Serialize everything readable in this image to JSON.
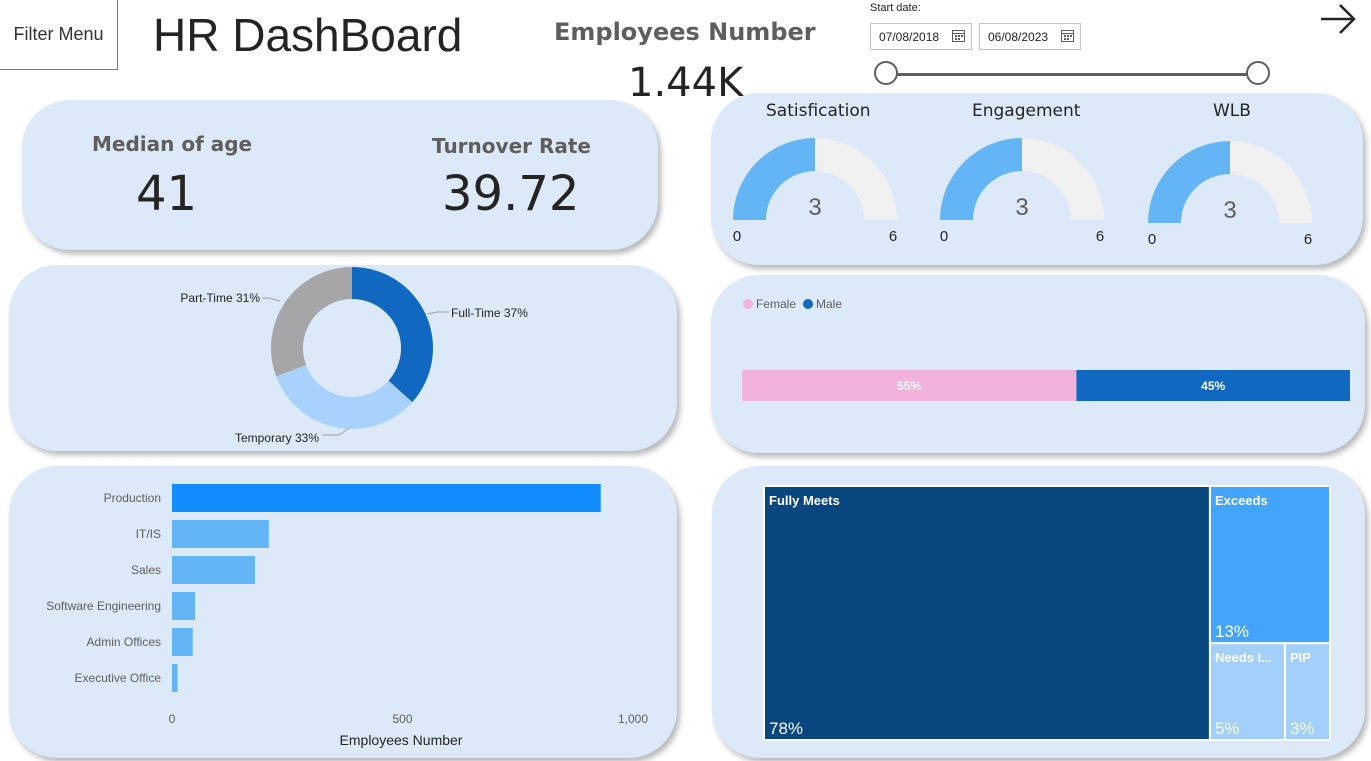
{
  "header": {
    "filter_menu_label": "Filter Menu",
    "title": "HR DashBoard",
    "employees_label": "Employees Number",
    "employees_value": "1.44K",
    "start_date_label": "Start date:",
    "start_date": "07/08/2018",
    "end_date": "06/08/2023",
    "arrow_icon": "arrow-right-icon",
    "slider": {
      "start_position": 0.0,
      "end_position": 1.0
    }
  },
  "kpis": {
    "median_age_label": "Median of age",
    "median_age_value": "41",
    "turnover_label": "Turnover Rate",
    "turnover_value": "39.72"
  },
  "gauges": [
    {
      "title": "Satisfication",
      "value": 3,
      "min": 0,
      "max": 6,
      "value_label": "3",
      "min_label": "0",
      "max_label": "6"
    },
    {
      "title": "Engagement",
      "value": 3,
      "min": 0,
      "max": 6,
      "value_label": "3",
      "min_label": "0",
      "max_label": "6"
    },
    {
      "title": "WLB",
      "value": 3,
      "min": 0,
      "max": 6,
      "value_label": "3",
      "min_label": "0",
      "max_label": "6"
    }
  ],
  "colors": {
    "card_bg": "#dce9f8",
    "gauge_fill": "#64b5f6",
    "gauge_track": "#f0f0f0",
    "female": "#f1b3db",
    "male": "#1068c0",
    "bar_primary": "#118dff",
    "bar_secondary": "#64b5f6",
    "full_time": "#1068c0",
    "temporary": "#a8d1fc",
    "part_time": "#a6a6a8",
    "tree_fully_meets": "#084680",
    "tree_exceeds": "#43a4fc",
    "tree_needs": "#a3cffb",
    "tree_pip": "#a3cffb"
  },
  "chart_data": [
    {
      "type": "pie",
      "donut": true,
      "labels": [
        "Full-Time",
        "Temporary",
        "Part-Time"
      ],
      "values": [
        37,
        33,
        31
      ],
      "data_labels": [
        "Full-Time 37%",
        "Temporary 33%",
        "Part-Time 31%"
      ]
    },
    {
      "type": "bar",
      "stacked": true,
      "orientation": "horizontal",
      "legend": [
        "Female",
        "Male"
      ],
      "legend_position": "top-left",
      "series": [
        {
          "name": "Female",
          "values": [
            55
          ],
          "label": "55%"
        },
        {
          "name": "Male",
          "values": [
            45
          ],
          "label": "45%"
        }
      ]
    },
    {
      "type": "bar",
      "orientation": "horizontal",
      "categories": [
        "Production",
        "IT/IS",
        "Sales",
        "Software Engineering",
        "Admin Offices",
        "Executive Office"
      ],
      "values": [
        930,
        210,
        180,
        50,
        45,
        12
      ],
      "xlabel": "Employees Number",
      "xlim": [
        0,
        1000
      ],
      "x_ticks": [
        "0",
        "500",
        "1,000"
      ]
    },
    {
      "type": "treemap",
      "categories": [
        "Fully Meets",
        "Exceeds",
        "Needs I...",
        "PIP"
      ],
      "values": [
        78,
        13,
        5,
        3
      ],
      "value_labels": [
        "78%",
        "13%",
        "5%",
        "3%"
      ]
    }
  ]
}
